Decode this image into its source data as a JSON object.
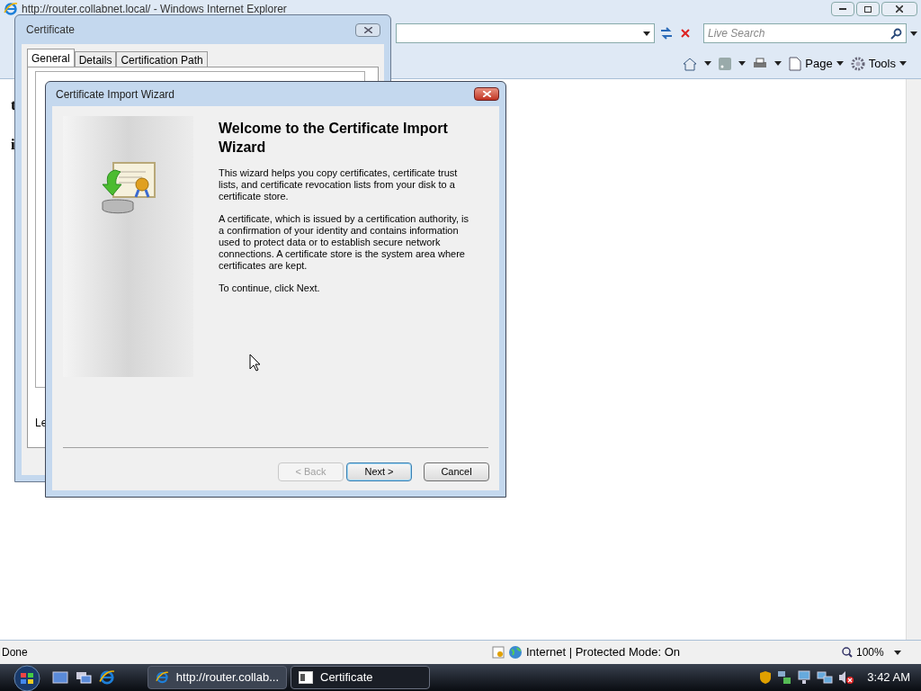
{
  "browser": {
    "title": "http://router.collabnet.local/ - Windows Internet Explorer",
    "search_placeholder": "Live Search",
    "toolbar": [
      {
        "label": "Page"
      },
      {
        "label": "Tools"
      }
    ],
    "page_fragments": [
      "t",
      "i"
    ],
    "status": {
      "text": "Done",
      "zone": "Internet | Protected Mode: On",
      "zoom": "100%"
    }
  },
  "certificate_dialog": {
    "title": "Certificate",
    "tabs": [
      {
        "label": "General",
        "selected": true
      },
      {
        "label": "Details",
        "selected": false
      },
      {
        "label": "Certification Path",
        "selected": false
      }
    ],
    "fragment": "Le"
  },
  "wizard": {
    "title": "Certificate Import Wizard",
    "heading": "Welcome to the Certificate Import Wizard",
    "paragraphs": [
      "This wizard helps you copy certificates, certificate trust lists, and certificate revocation lists from your disk to a certificate store.",
      "A certificate, which is issued by a certification authority, is a confirmation of your identity and contains information used to protect data or to establish secure network connections. A certificate store is the system area where certificates are kept.",
      "To continue, click Next."
    ],
    "buttons": [
      {
        "label": "< Back",
        "disabled": true,
        "default": false
      },
      {
        "label": "Next >",
        "disabled": false,
        "default": true
      },
      {
        "label": "Cancel",
        "disabled": false,
        "default": false
      }
    ]
  },
  "taskbar": {
    "tasks": [
      {
        "label": "http://router.collab...",
        "kind": "browser",
        "selected": false
      },
      {
        "label": "Certificate",
        "kind": "dialog",
        "selected": true
      }
    ],
    "clock": "3:42 AM"
  }
}
